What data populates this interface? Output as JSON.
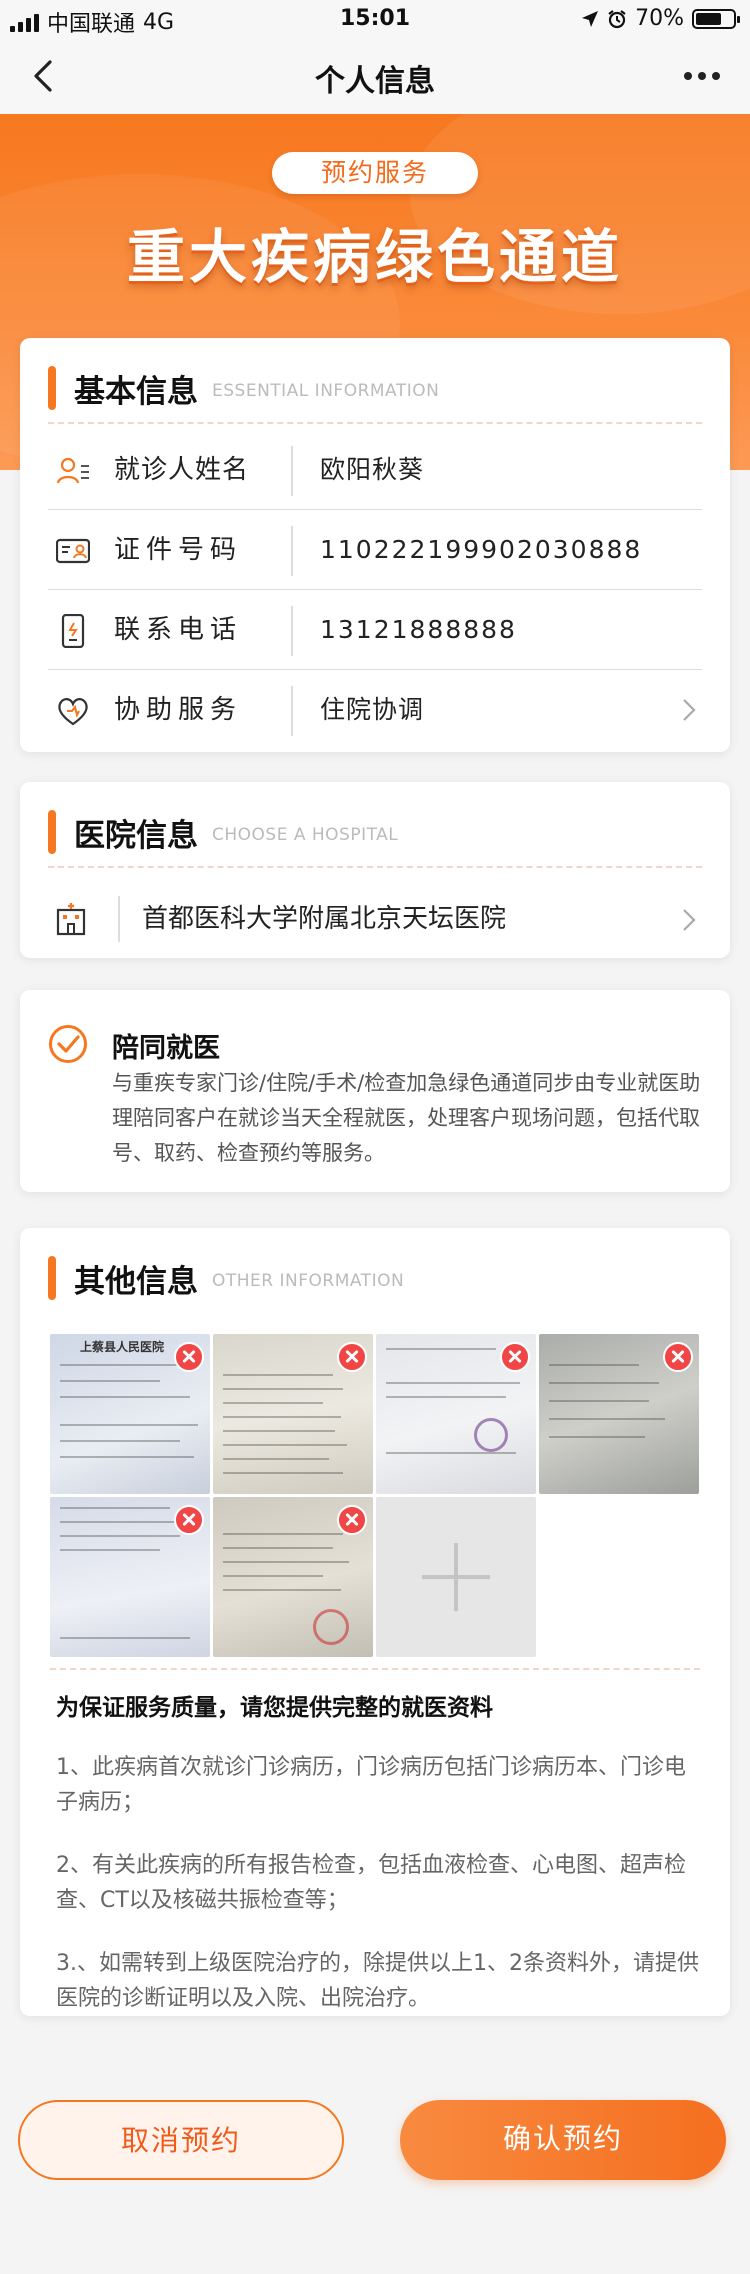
{
  "status_bar": {
    "carrier": "中国联通",
    "network": "4G",
    "time": "15:01",
    "battery": "70%",
    "battery_level": 0.7
  },
  "nav": {
    "title": "个人信息",
    "back_icon": "chevron-left-icon",
    "more_icon": "more-dots-icon"
  },
  "banner": {
    "pill_label": "预约服务",
    "headline": "重大疾病绿色通道"
  },
  "basic_info": {
    "title": "基本信息",
    "subtitle": "ESSENTIAL INFORMATION",
    "rows": [
      {
        "icon": "person-icon",
        "label": "就诊人姓名",
        "value": "欧阳秋葵"
      },
      {
        "icon": "id-card-icon",
        "label": "证件号码",
        "value": "110222199902030888"
      },
      {
        "icon": "phone-icon",
        "label": "联系电话",
        "value": "13121888888"
      },
      {
        "icon": "heart-hand-icon",
        "label": "协助服务",
        "value": "住院协调"
      }
    ]
  },
  "hospital_info": {
    "title": "医院信息",
    "subtitle": "CHOOSE A HOSPITAL",
    "hospital": "首都医科大学附属北京天坛医院"
  },
  "escort": {
    "checked": true,
    "title": "陪同就医",
    "description": "与重疾专家门诊/住院/手术/检查加急绿色通道同步由专业就医助理陪同客户在就诊当天全程就医，处理客户现场问题，包括代取号、取药、检查预约等服务。"
  },
  "other_info": {
    "title": "其他信息",
    "subtitle": "OTHER INFORMATION",
    "images": [
      {
        "name": "report-image-1",
        "thumb_text": "上蔡县人民医院"
      },
      {
        "name": "report-image-2"
      },
      {
        "name": "report-image-3"
      },
      {
        "name": "report-image-4"
      },
      {
        "name": "report-image-5"
      },
      {
        "name": "report-image-6"
      }
    ],
    "notice_title": "为保证服务质量，请您提供完整的就医资料",
    "notices": [
      "1、此疾病首次就诊门诊病历，门诊病历包括门诊病历本、门诊电子病历；",
      "2、有关此疾病的所有报告检查，包括血液检查、心电图、超声检查、CT以及核磁共振检查等；",
      "3.、如需转到上级医院治疗的，除提供以上1、2条资料外，请提供医院的诊断证明以及入院、出院治疗。"
    ]
  },
  "actions": {
    "cancel": "取消预约",
    "confirm": "确认预约"
  },
  "colors": {
    "accent": "#f5771f",
    "delete": "#f04646"
  }
}
